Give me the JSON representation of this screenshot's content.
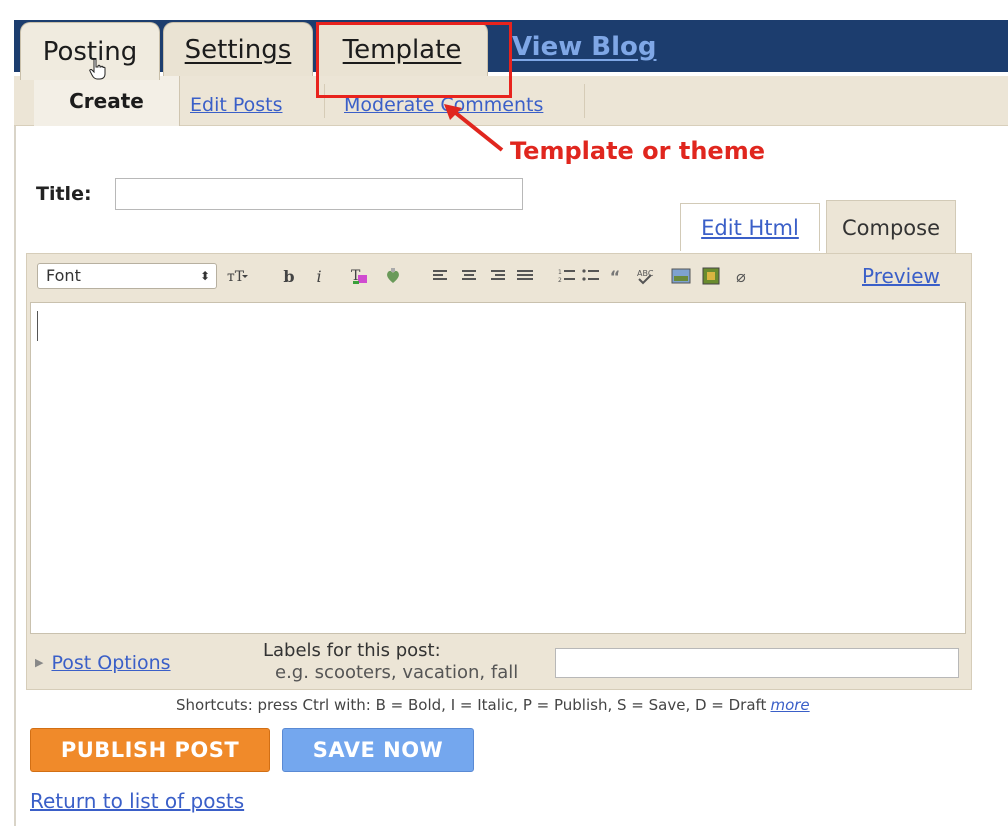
{
  "tabs": {
    "posting": "Posting",
    "settings": "Settings",
    "template": "Template",
    "view_blog": "View Blog"
  },
  "subnav": {
    "create": "Create",
    "edit_posts": "Edit Posts",
    "moderate_comments": "Moderate Comments"
  },
  "annotation": {
    "text": "Template or theme",
    "color": "#e0261e"
  },
  "editor": {
    "title_label": "Title:",
    "title_value": "",
    "edit_html_tab": "Edit Html",
    "compose_tab": "Compose",
    "font_select": "Font",
    "preview_link": "Preview",
    "body_text": ""
  },
  "toolbar_icons": [
    "font-size-icon",
    "bold-icon",
    "italic-icon",
    "text-color-icon",
    "link-icon",
    "align-left-icon",
    "align-center-icon",
    "align-right-icon",
    "justify-icon",
    "numbered-list-icon",
    "bulleted-list-icon",
    "blockquote-icon",
    "spellcheck-icon",
    "image-icon",
    "video-icon",
    "eraser-icon"
  ],
  "footer": {
    "post_options": "Post Options",
    "labels_title": "Labels for this post:",
    "labels_example": "e.g. scooters, vacation, fall",
    "labels_value": ""
  },
  "shortcuts": {
    "text": "Shortcuts: press Ctrl with: B = Bold, I = Italic, P = Publish, S = Save, D = Draft",
    "more": "more"
  },
  "actions": {
    "publish": "PUBLISH POST",
    "save": "SAVE NOW",
    "return": "Return to list of posts"
  },
  "colors": {
    "top_band": "#1c3d6e",
    "publish_button": "#f08a2a",
    "save_button": "#74a7ee",
    "link": "#3a5fc8"
  }
}
